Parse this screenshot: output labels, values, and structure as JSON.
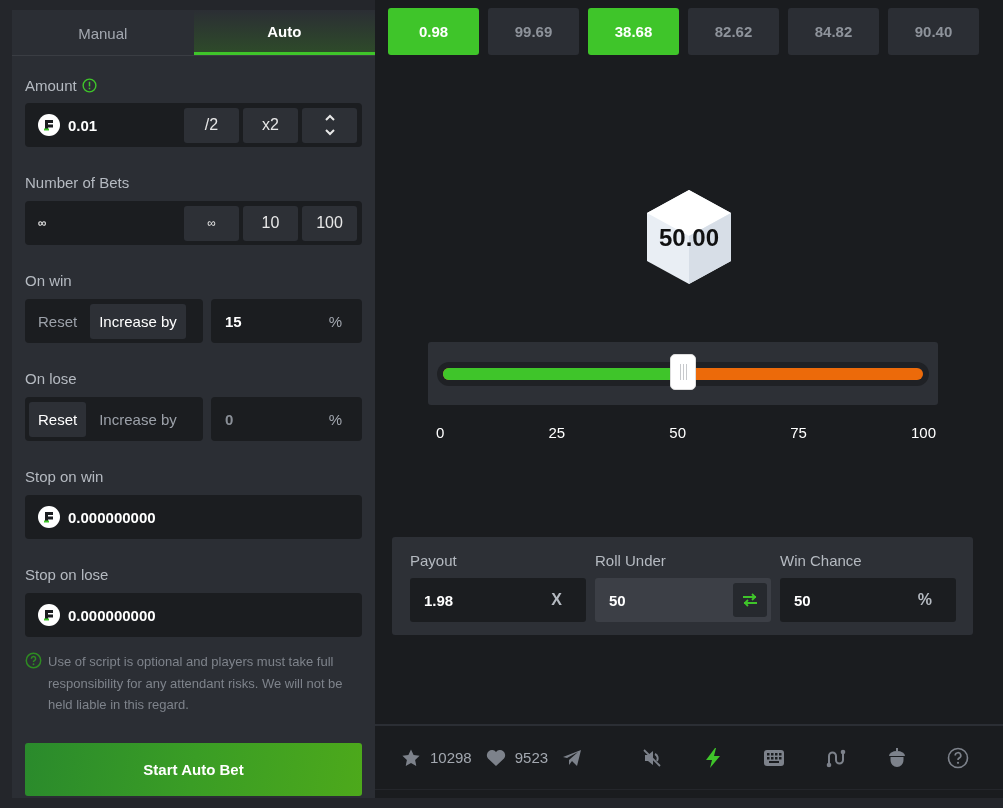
{
  "tabs": [
    {
      "label": "Manual",
      "selected": false
    },
    {
      "label": "Auto",
      "selected": true
    }
  ],
  "amount": {
    "label": "Amount",
    "value": "0.01",
    "buttons": [
      "/2",
      "x2"
    ]
  },
  "number_of_bets": {
    "label": "Number of Bets",
    "value": "∞",
    "buttons": [
      "∞",
      "10",
      "100"
    ]
  },
  "on_win": {
    "label": "On win",
    "options": [
      {
        "label": "Reset",
        "selected": false
      },
      {
        "label": "Increase by",
        "selected": true
      }
    ],
    "value": "15",
    "unit": "%"
  },
  "on_lose": {
    "label": "On lose",
    "options": [
      {
        "label": "Reset",
        "selected": true
      },
      {
        "label": "Increase by",
        "selected": false
      }
    ],
    "value": "0",
    "unit": "%"
  },
  "stop_on_win": {
    "label": "Stop on win",
    "value": "0.000000000"
  },
  "stop_on_lose": {
    "label": "Stop on lose",
    "value": "0.000000000"
  },
  "disclaimer": "Use of script is optional and players must take full responsibility for any attendant risks. We will not be held liable in this regard.",
  "start_button": "Start Auto Bet",
  "history": [
    {
      "value": "0.98",
      "win": true
    },
    {
      "value": "99.69",
      "win": false
    },
    {
      "value": "38.68",
      "win": true
    },
    {
      "value": "82.62",
      "win": false
    },
    {
      "value": "84.82",
      "win": false
    },
    {
      "value": "90.40",
      "win": false
    }
  ],
  "dice": {
    "value": "50.00"
  },
  "slider": {
    "level": 0.5,
    "ticks": [
      "0",
      "25",
      "50",
      "75",
      "100"
    ]
  },
  "stats": {
    "payout": {
      "label": "Payout",
      "value": "1.98",
      "unit": "X"
    },
    "roll_under": {
      "label": "Roll Under",
      "value": "50"
    },
    "win_chance": {
      "label": "Win Chance",
      "value": "50",
      "unit": "%"
    }
  },
  "footer": {
    "favorites": "10298",
    "likes": "9523",
    "tools": [
      {
        "kind": "mute",
        "on": false
      },
      {
        "kind": "bolt",
        "on": true
      },
      {
        "kind": "keyboard",
        "on": false
      },
      {
        "kind": "curve",
        "on": false
      },
      {
        "kind": "acorn",
        "on": false
      },
      {
        "kind": "help",
        "on": false
      }
    ]
  }
}
